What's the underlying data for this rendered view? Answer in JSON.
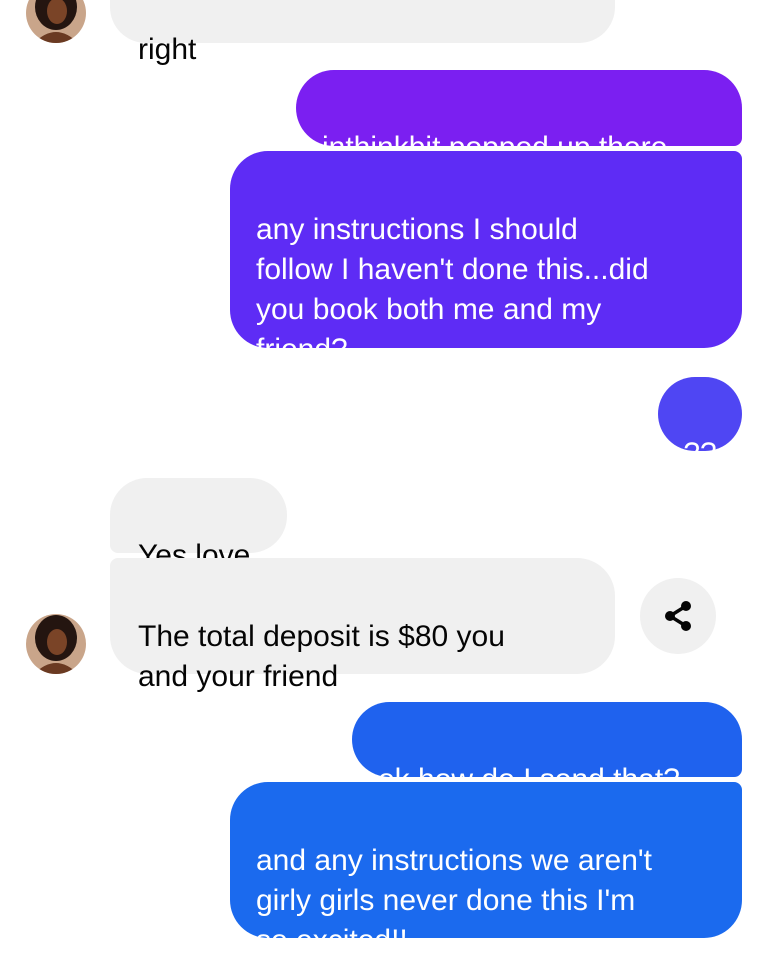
{
  "thread": {
    "messages": [
      {
        "sender": "contact",
        "text": "right"
      },
      {
        "sender": "me",
        "text": "inthinkbit popped up there"
      },
      {
        "sender": "me",
        "text": "any instructions I should\nfollow I haven't done this...did\nyou book both me and my\nfriend?"
      },
      {
        "sender": "me",
        "text": "??"
      },
      {
        "sender": "contact",
        "text": "Yes love"
      },
      {
        "sender": "contact",
        "text": "The total deposit is $80 you\nand your friend"
      },
      {
        "sender": "me",
        "text": "ok how do I send that?"
      },
      {
        "sender": "me",
        "text": "and any instructions we aren't\ngirly girls never done this I'm\nso excited!!"
      }
    ]
  },
  "icons": {
    "share": "share-icon",
    "avatar": "contact-avatar"
  },
  "colors": {
    "incoming_bubble": "#f0f0f0",
    "outgoing_purple": "#7b1ff1",
    "outgoing_violet": "#5e2cf5",
    "outgoing_indigo": "#4f46f3",
    "outgoing_blue": "#1f62ee",
    "outgoing_blue_2": "#1b6aee"
  }
}
